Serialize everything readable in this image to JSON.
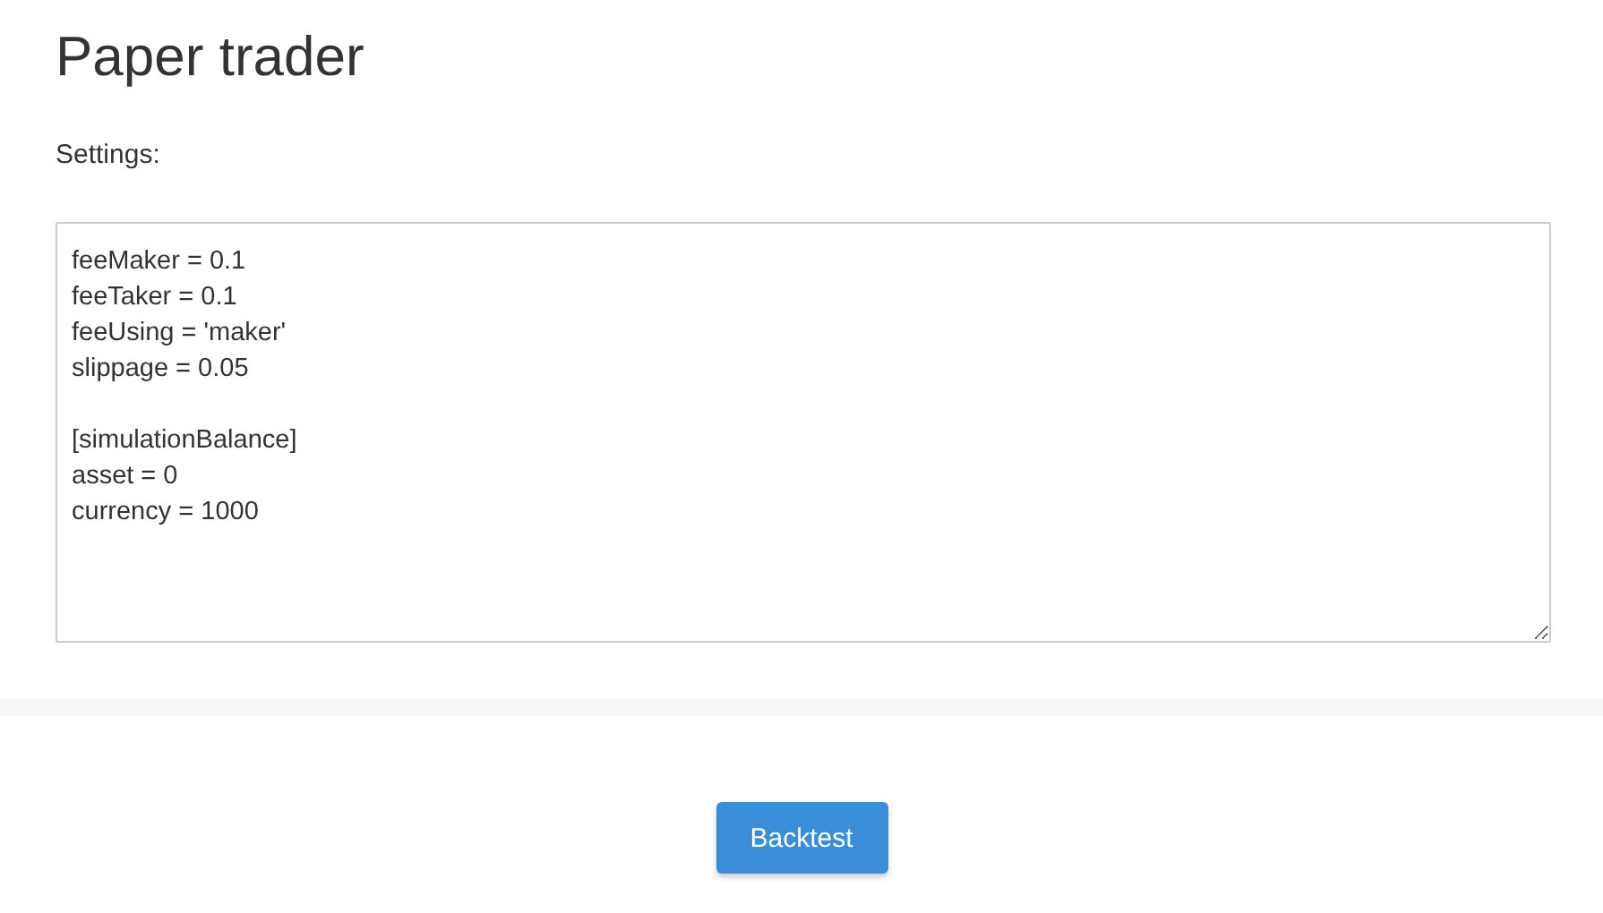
{
  "title": "Paper trader",
  "settings": {
    "label": "Settings:",
    "value": "feeMaker = 0.1\nfeeTaker = 0.1\nfeeUsing = 'maker'\nslippage = 0.05\n\n[simulationBalance]\nasset = 0\ncurrency = 1000"
  },
  "buttons": [
    {
      "label": "Backtest"
    }
  ]
}
